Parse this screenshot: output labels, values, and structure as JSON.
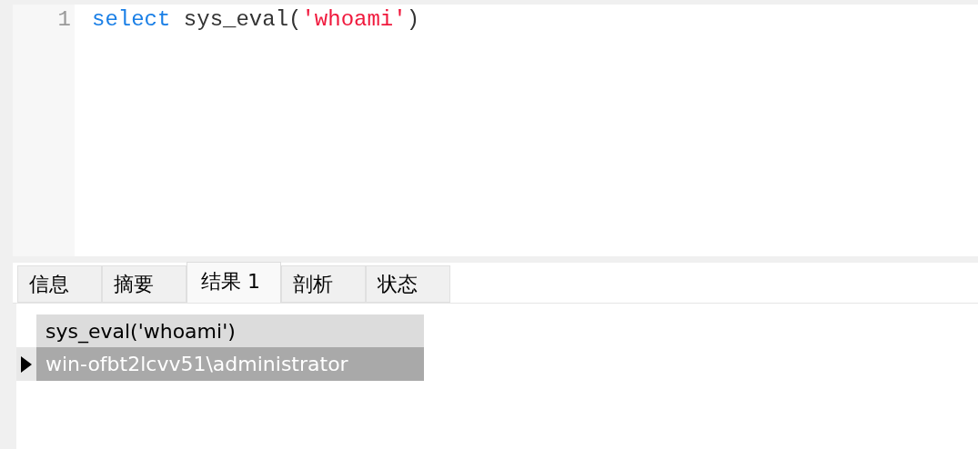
{
  "editor": {
    "lines": [
      {
        "number": "1",
        "tokens": [
          {
            "kind": "keyword",
            "text": "select"
          },
          {
            "kind": "plain",
            "text": " sys_eval("
          },
          {
            "kind": "string",
            "text": "'whoami'"
          },
          {
            "kind": "plain",
            "text": ")"
          }
        ]
      }
    ]
  },
  "tabs": [
    {
      "label": "信息",
      "selected": false
    },
    {
      "label": "摘要",
      "selected": false
    },
    {
      "label": "结果 1",
      "selected": true
    },
    {
      "label": "剖析",
      "selected": false
    },
    {
      "label": "状态",
      "selected": false
    }
  ],
  "result": {
    "columns": [
      "sys_eval('whoami')"
    ],
    "rows": [
      {
        "cells": [
          "win-ofbt2lcvv51\\administrator"
        ],
        "selected": true
      }
    ]
  }
}
